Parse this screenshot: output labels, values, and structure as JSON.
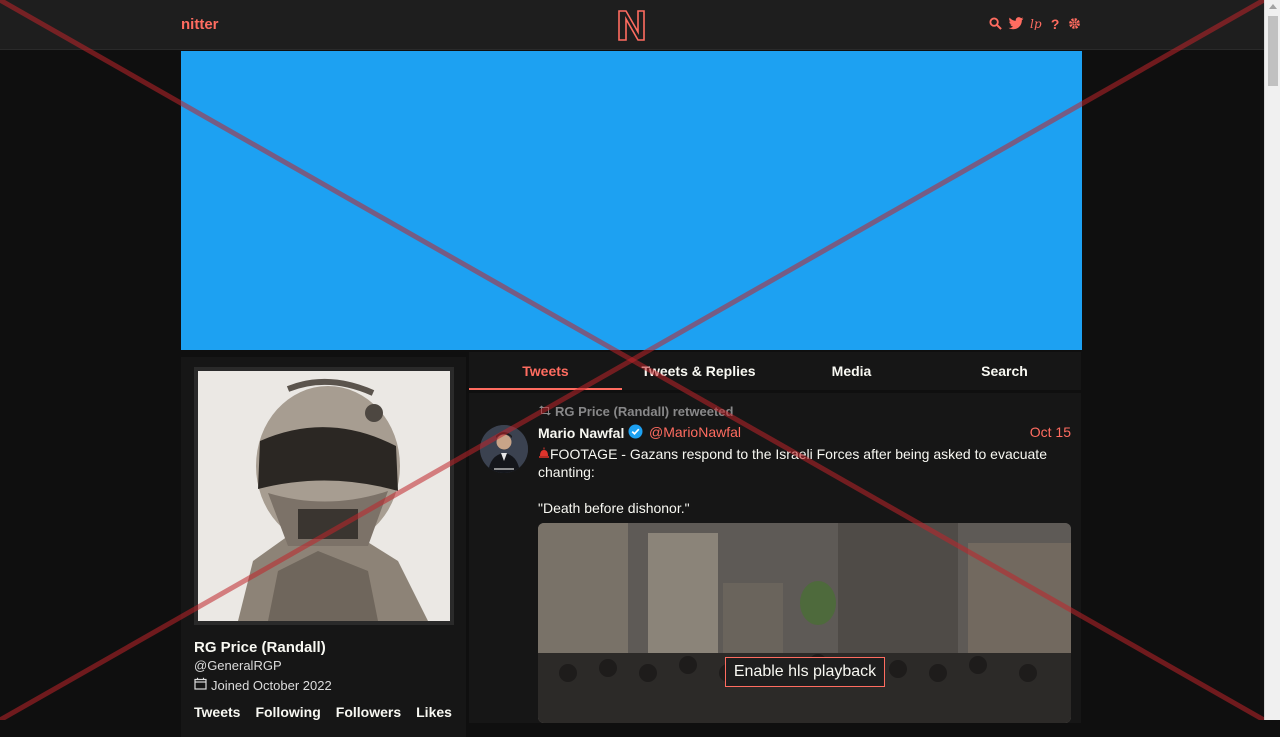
{
  "nav": {
    "brand": "nitter",
    "icons": [
      "search-icon",
      "twitter-icon",
      "rss-icon",
      "help-icon",
      "gear-icon"
    ]
  },
  "colors": {
    "accent": "#ff6c60",
    "banner": "#1da1f2",
    "background": "#0f0f0f",
    "panel": "#161616"
  },
  "profile": {
    "name": "RG Price (Randall)",
    "handle": "@GeneralRGP",
    "joined": "Joined October 2022",
    "stats": [
      "Tweets",
      "Following",
      "Followers",
      "Likes"
    ]
  },
  "tabs": [
    {
      "label": "Tweets",
      "active": true
    },
    {
      "label": "Tweets & Replies",
      "active": false
    },
    {
      "label": "Media",
      "active": false
    },
    {
      "label": "Search",
      "active": false
    }
  ],
  "tweet": {
    "retweet_label": "RG Price (Randall) retweeted",
    "author_name": "Mario Nawfal",
    "author_handle": "@MarioNawfal",
    "date": "Oct 15",
    "text_line1": "FOOTAGE - Gazans respond to the Israeli Forces after being asked to evacuate chanting:",
    "text_line2": "\"Death before dishonor.\"",
    "media_button": "Enable hls playback"
  }
}
